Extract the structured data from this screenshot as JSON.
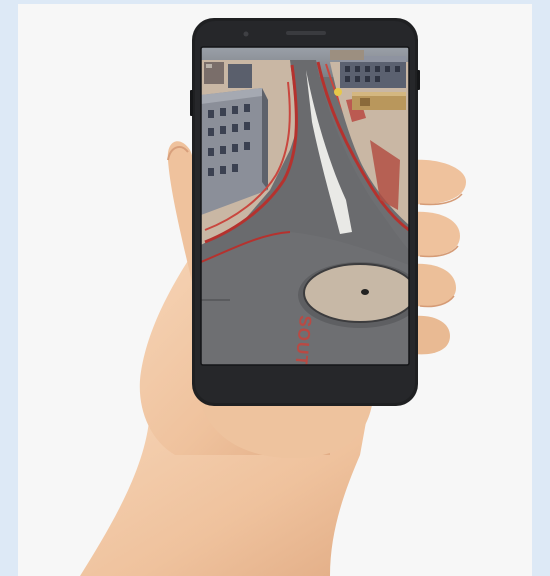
{
  "scene": {
    "road_marking_text": "SOUTH",
    "colors": {
      "page_background": "#dde9f6",
      "photo_background": "#f7f7f7",
      "phone_body": "#1f2022",
      "screen_road": "#6e6f72",
      "curb_red": "#b5322e",
      "sidewalk_tan": "#c9b7a4",
      "skin": "#f1c9a6"
    },
    "icons": {
      "phone": "smartphone-icon",
      "hand": "hand-icon"
    }
  }
}
